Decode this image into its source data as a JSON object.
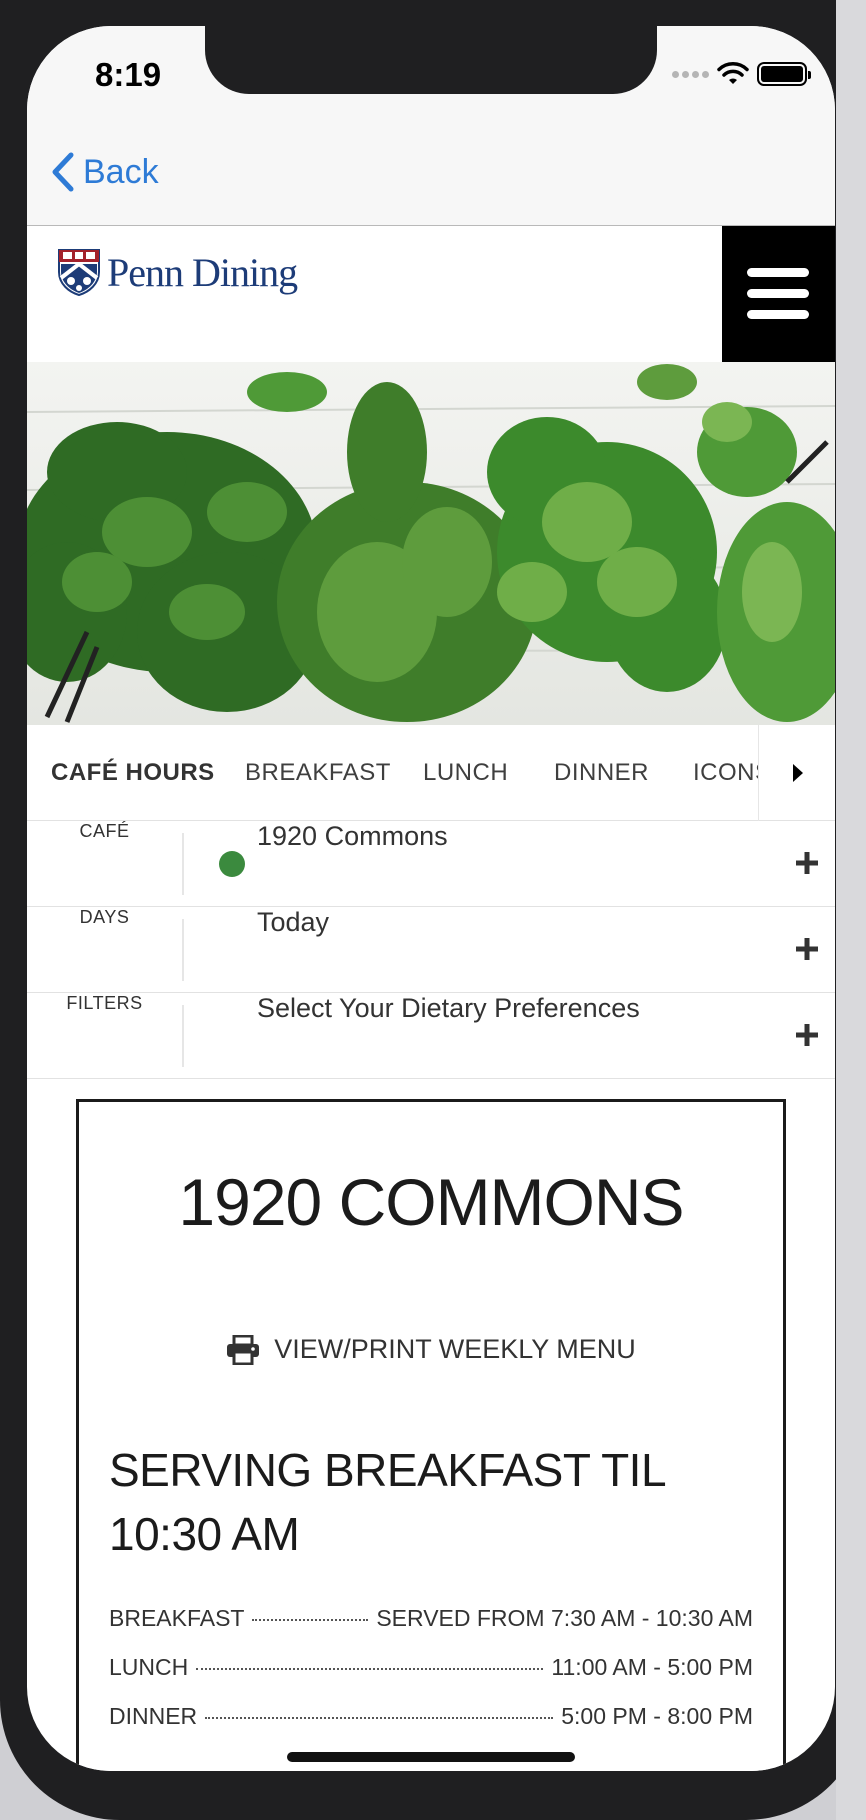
{
  "status_bar": {
    "time": "8:19"
  },
  "nav": {
    "back_label": "Back"
  },
  "header": {
    "logo_text": "Penn Dining"
  },
  "tabs": [
    {
      "label": "CAFÉ HOURS",
      "active": true
    },
    {
      "label": "BREAKFAST",
      "active": false
    },
    {
      "label": "LUNCH",
      "active": false
    },
    {
      "label": "DINNER",
      "active": false
    },
    {
      "label": "ICONS",
      "active": false
    }
  ],
  "filters": {
    "cafe": {
      "label": "CAFÉ",
      "value": "1920 Commons",
      "status_color": "#3b8a3e"
    },
    "days": {
      "label": "DAYS",
      "value": "Today"
    },
    "dietary": {
      "label": "FILTERS",
      "value": "Select Your Dietary Preferences"
    }
  },
  "card": {
    "title": "1920 COMMONS",
    "print_label": "VIEW/PRINT WEEKLY MENU",
    "serving_status": "SERVING BREAKFAST TIL 10:30 AM",
    "meals": [
      {
        "name": "BREAKFAST",
        "time": "SERVED FROM 7:30 AM - 10:30 AM"
      },
      {
        "name": "LUNCH",
        "time": "11:00 AM - 5:00 PM"
      },
      {
        "name": "DINNER",
        "time": "5:00 PM - 8:00 PM"
      }
    ]
  },
  "colors": {
    "link_blue": "#2e7bd6",
    "brand_navy": "#1d3c78",
    "open_green": "#3b8a3e"
  },
  "icons": [
    "chevron-left-icon",
    "wifi-icon",
    "battery-icon",
    "penn-shield-icon",
    "hamburger-menu-icon",
    "caret-right-icon",
    "plus-icon",
    "printer-icon"
  ]
}
